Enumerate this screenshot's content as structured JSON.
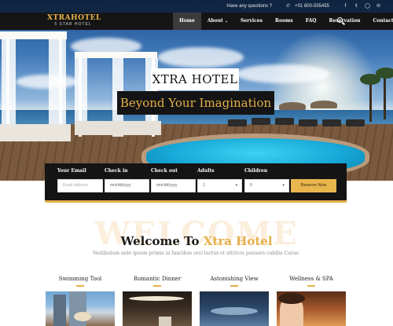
{
  "topbar": {
    "question": "Have any questions ?",
    "phone": "+01 800-555455",
    "social_icons": [
      "facebook-icon",
      "twitter-icon",
      "instagram-icon",
      "pinterest-icon"
    ]
  },
  "brand": {
    "name": "XTRAHOTEL",
    "subtitle": "5 STAR HOTEL"
  },
  "nav": {
    "items": [
      {
        "label": "Home",
        "active": true
      },
      {
        "label": "About",
        "dropdown": true
      },
      {
        "label": "Services"
      },
      {
        "label": "Rooms"
      },
      {
        "label": "FAQ"
      },
      {
        "label": "Reservation"
      },
      {
        "label": "Contact"
      }
    ]
  },
  "hero": {
    "title": "XTRA HOTEL",
    "tagline": "Beyond Your Imagination"
  },
  "booking": {
    "email_label": "Your Email",
    "email_placeholder": "Email address",
    "checkin_label": "Check in",
    "checkin_value": "mm/dd/yyyy",
    "checkout_label": "Check out",
    "checkout_value": "mm/dd/yyyy",
    "adults_label": "Adults",
    "adults_value": "1",
    "children_label": "Children",
    "children_value": "0",
    "submit_label": "Reserve Now"
  },
  "welcome": {
    "background_word": "WELCOME",
    "title_prefix": "Welcome To ",
    "title_accent": "Xtra Hotel",
    "subtitle": "Vestibulum ante ipsum primis in faucibus orci luctus et ultrices posuere cubilia Curae."
  },
  "features": [
    {
      "title": "Swimming Tool"
    },
    {
      "title": "Romantic Dinner"
    },
    {
      "title": "Astonishing View"
    },
    {
      "title": "Wellness & SPA"
    }
  ],
  "colors": {
    "accent": "#e5b04a",
    "nav_bg": "#151515",
    "booking_bg": "#141414"
  }
}
